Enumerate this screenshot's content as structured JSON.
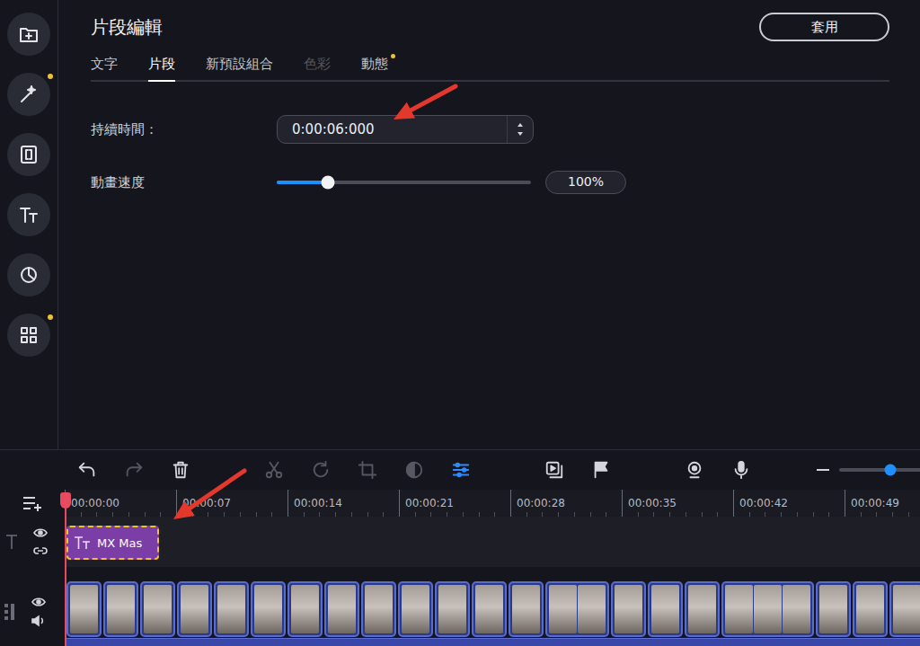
{
  "sidebar": {
    "items": [
      {
        "kind": "import",
        "badge": false
      },
      {
        "kind": "effects",
        "badge": true
      },
      {
        "kind": "transitions",
        "badge": false
      },
      {
        "kind": "titles",
        "badge": false
      },
      {
        "kind": "stickers",
        "badge": false
      },
      {
        "kind": "more",
        "badge": true
      }
    ]
  },
  "panel": {
    "title": "片段編輯",
    "apply_button": "套用"
  },
  "tabs": [
    {
      "label": "文字",
      "selected": false,
      "disabled": false,
      "badge": false
    },
    {
      "label": "片段",
      "selected": true,
      "disabled": false,
      "badge": false
    },
    {
      "label": "新預設組合",
      "selected": false,
      "disabled": false,
      "badge": false
    },
    {
      "label": "色彩",
      "selected": false,
      "disabled": true,
      "badge": false
    },
    {
      "label": "動態",
      "selected": false,
      "disabled": false,
      "badge": true
    }
  ],
  "fields": {
    "duration": {
      "label": "持續時間：",
      "value": "0:00:06:000"
    },
    "speed": {
      "label": "動畫速度",
      "level": 0.2,
      "reading": "100%"
    }
  },
  "toolbar": {
    "groups": [
      [
        {
          "kind": "undo",
          "disabled": false,
          "active": false
        },
        {
          "kind": "redo",
          "disabled": true,
          "active": false
        },
        {
          "kind": "delete",
          "disabled": false,
          "active": false
        }
      ],
      [
        {
          "kind": "cut",
          "disabled": true,
          "active": false
        },
        {
          "kind": "rotate",
          "disabled": true,
          "active": false
        },
        {
          "kind": "crop",
          "disabled": true,
          "active": false
        },
        {
          "kind": "color",
          "disabled": true,
          "active": false
        },
        {
          "kind": "properties",
          "disabled": false,
          "active": true
        }
      ],
      [
        {
          "kind": "overlay",
          "disabled": false,
          "active": false
        },
        {
          "kind": "marker",
          "disabled": false,
          "active": false
        }
      ],
      [
        {
          "kind": "webcam",
          "disabled": false,
          "active": false
        },
        {
          "kind": "voice",
          "disabled": false,
          "active": false
        }
      ]
    ],
    "zoom": {
      "level": 0.57
    }
  },
  "timeline": {
    "ruler": [
      "00:00:00",
      "00:00:07",
      "00:00:14",
      "00:00:21",
      "00:00:28",
      "00:00:35",
      "00:00:42",
      "00:00:49"
    ],
    "title_track": {
      "visible": true,
      "clips": [
        {
          "label": "MX Mas",
          "selected": true
        }
      ]
    },
    "video_track": {
      "visible": true,
      "muted": false,
      "clips": [
        {
          "frames": 1
        },
        {
          "frames": 1
        },
        {
          "frames": 1
        },
        {
          "frames": 1
        },
        {
          "frames": 1
        },
        {
          "frames": 1
        },
        {
          "frames": 1
        },
        {
          "frames": 1
        },
        {
          "frames": 1
        },
        {
          "frames": 1
        },
        {
          "frames": 1
        },
        {
          "frames": 1
        },
        {
          "frames": 1
        },
        {
          "frames": 2
        },
        {
          "frames": 1
        },
        {
          "frames": 1
        },
        {
          "frames": 1
        },
        {
          "frames": 3
        },
        {
          "frames": 1
        },
        {
          "frames": 1
        },
        {
          "frames": 1
        },
        {
          "frames": 1
        },
        {
          "frames": 1
        },
        {
          "frames": 1
        }
      ]
    }
  }
}
